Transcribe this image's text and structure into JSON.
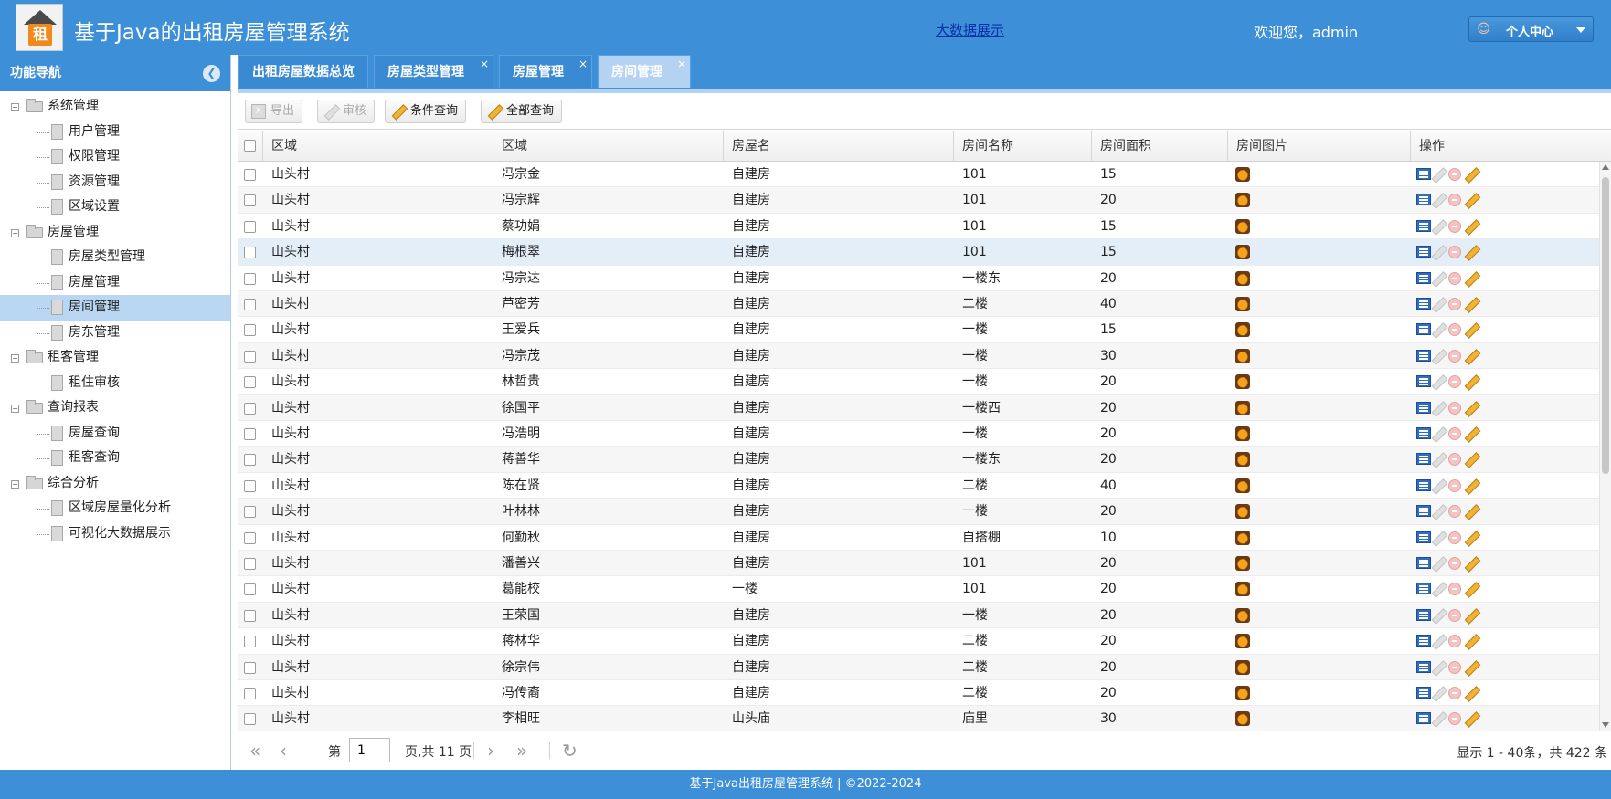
{
  "header": {
    "logo_char": "租",
    "title": "基于Java的出租房屋管理系统",
    "big_data_link": "大数据展示",
    "welcome": "欢迎您，admin",
    "user_menu_label": "个人中心"
  },
  "sidebar": {
    "title": "功能导航",
    "groups": [
      {
        "label": "系统管理",
        "items": [
          "用户管理",
          "权限管理",
          "资源管理",
          "区域设置"
        ]
      },
      {
        "label": "房屋管理",
        "items": [
          "房屋类型管理",
          "房屋管理",
          "房间管理",
          "房东管理"
        ]
      },
      {
        "label": "租客管理",
        "items": [
          "租住审核"
        ]
      },
      {
        "label": "查询报表",
        "items": [
          "房屋查询",
          "租客查询"
        ]
      },
      {
        "label": "综合分析",
        "items": [
          "区域房屋量化分析",
          "可视化大数据展示"
        ]
      }
    ],
    "selected_item": "房间管理"
  },
  "tabs": [
    {
      "label": "出租房屋数据总览",
      "closable": false
    },
    {
      "label": "房屋类型管理",
      "closable": true
    },
    {
      "label": "房屋管理",
      "closable": true
    },
    {
      "label": "房间管理",
      "closable": true,
      "active": true
    }
  ],
  "toolbar": {
    "export_label": "导出",
    "audit_label": "审核",
    "condition_query_label": "条件查询",
    "all_query_label": "全部查询"
  },
  "grid": {
    "columns": [
      "区域",
      "区域",
      "房屋名",
      "房间名称",
      "房间面积",
      "房间图片",
      "操作"
    ],
    "rows": [
      [
        "山头村",
        "冯宗金",
        "自建房",
        "101",
        "15"
      ],
      [
        "山头村",
        "冯宗辉",
        "自建房",
        "101",
        "20"
      ],
      [
        "山头村",
        "蔡功娟",
        "自建房",
        "101",
        "15"
      ],
      [
        "山头村",
        "梅根翠",
        "自建房",
        "101",
        "15"
      ],
      [
        "山头村",
        "冯宗达",
        "自建房",
        "一楼东",
        "20"
      ],
      [
        "山头村",
        "芦密芳",
        "自建房",
        "二楼",
        "40"
      ],
      [
        "山头村",
        "王爱兵",
        "自建房",
        "一楼",
        "15"
      ],
      [
        "山头村",
        "冯宗茂",
        "自建房",
        "一楼",
        "30"
      ],
      [
        "山头村",
        "林哲贵",
        "自建房",
        "一楼",
        "20"
      ],
      [
        "山头村",
        "徐国平",
        "自建房",
        "一楼西",
        "20"
      ],
      [
        "山头村",
        "冯浩明",
        "自建房",
        "一楼",
        "20"
      ],
      [
        "山头村",
        "蒋善华",
        "自建房",
        "一楼东",
        "20"
      ],
      [
        "山头村",
        "陈在贤",
        "自建房",
        "二楼",
        "40"
      ],
      [
        "山头村",
        "叶林林",
        "自建房",
        "一楼",
        "20"
      ],
      [
        "山头村",
        "何勤秋",
        "自建房",
        "自搭棚",
        "10"
      ],
      [
        "山头村",
        "潘善兴",
        "自建房",
        "101",
        "20"
      ],
      [
        "山头村",
        "葛能校",
        "一楼",
        "101",
        "20"
      ],
      [
        "山头村",
        "王荣国",
        "自建房",
        "一楼",
        "20"
      ],
      [
        "山头村",
        "蒋林华",
        "自建房",
        "二楼",
        "20"
      ],
      [
        "山头村",
        "徐宗伟",
        "自建房",
        "二楼",
        "20"
      ],
      [
        "山头村",
        "冯传裔",
        "自建房",
        "二楼",
        "20"
      ],
      [
        "山头村",
        "李相旺",
        "山头庙",
        "庙里",
        "30"
      ]
    ],
    "highlighted_row": 3
  },
  "pager": {
    "page_prefix": "第",
    "page_value": "1",
    "page_suffix": "页,共 11 页",
    "info": "显示 1 - 40条，共 422 条"
  },
  "footer": {
    "text": "基于Java出租房屋管理系统 |   ©2022-2024"
  },
  "colors": {
    "primary": "#3d8fd8",
    "active_tab": "#b4d3f2",
    "selected_tree": "#b9d7f3",
    "link": "#0b2fa8"
  },
  "icons": {
    "logo": "house-rent-logo-icon",
    "collapse": "chevron-left-circle-icon",
    "user": "user-icon",
    "room_picture": "image-icon",
    "ops": [
      "detail-icon",
      "edit-icon",
      "delete-icon",
      "audit-icon"
    ]
  }
}
